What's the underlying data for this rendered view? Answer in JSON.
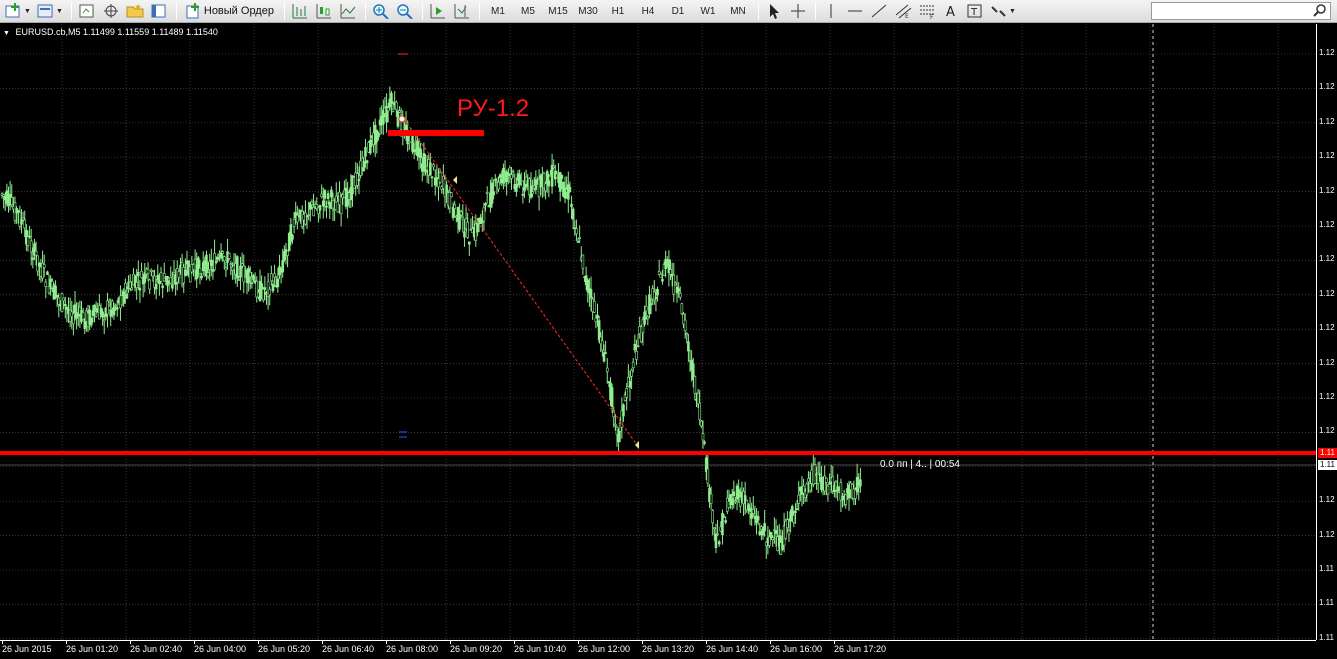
{
  "toolbar": {
    "new_order_label": "Новый Ордер",
    "timeframes": [
      "M1",
      "M5",
      "M15",
      "M30",
      "H1",
      "H4",
      "D1",
      "W1",
      "MN"
    ],
    "search_placeholder": ""
  },
  "chart": {
    "header": "EURUSD.cb,M5  1.11499 1.11559 1.11489 1.11540",
    "annotation": "РУ-1.2",
    "order_info": "0.0 пп | 4.. | 00:54",
    "price_labels": [
      "1.12",
      "1.12",
      "1.12",
      "1.12",
      "1.12",
      "1.12",
      "1.12",
      "1.12",
      "1.12",
      "1.12",
      "1.12",
      "1.12",
      "1.12",
      "1.12",
      "1.12",
      "1.11",
      "1.11",
      "1.11",
      "1.11"
    ],
    "current_price_tag": "1.11",
    "level_price_tag": "1.11",
    "time_labels": [
      "26 Jun 2015",
      "26 Jun 01:20",
      "26 Jun 02:40",
      "26 Jun 04:00",
      "26 Jun 05:20",
      "26 Jun 06:40",
      "26 Jun 08:00",
      "26 Jun 09:20",
      "26 Jun 10:40",
      "26 Jun 12:00",
      "26 Jun 13:20",
      "26 Jun 14:40",
      "26 Jun 16:00",
      "26 Jun 17:20"
    ],
    "colors": {
      "background": "#000000",
      "grid": "#5a5a5a",
      "candle": "#90ee90",
      "level": "#ff0000",
      "annotation": "#ff1a1a"
    }
  },
  "chart_data": {
    "type": "line",
    "title": "EURUSD.cb,M5",
    "x": [
      "00:00",
      "00:20",
      "00:40",
      "01:00",
      "01:20",
      "01:40",
      "02:00",
      "02:20",
      "02:40",
      "03:00",
      "03:20",
      "03:40",
      "04:00",
      "04:20",
      "04:40",
      "05:00",
      "05:20",
      "05:40",
      "06:00",
      "06:20",
      "06:40",
      "07:00",
      "07:20",
      "07:40",
      "08:00",
      "08:20",
      "08:40",
      "09:00",
      "09:20",
      "09:40",
      "10:00",
      "10:20",
      "10:40",
      "11:00",
      "11:20",
      "11:40",
      "12:00",
      "12:20",
      "12:40",
      "13:00",
      "13:20",
      "13:40",
      "14:00",
      "14:20",
      "14:40",
      "15:00",
      "15:20",
      "15:40",
      "16:00",
      "16:20",
      "16:40",
      "17:00",
      "17:20",
      "17:40"
    ],
    "y": [
      170,
      190,
      230,
      265,
      285,
      295,
      290,
      280,
      262,
      255,
      258,
      250,
      245,
      240,
      235,
      252,
      268,
      255,
      200,
      185,
      175,
      180,
      150,
      110,
      80,
      110,
      140,
      155,
      190,
      215,
      175,
      150,
      160,
      165,
      150,
      170,
      255,
      320,
      410,
      330,
      275,
      240,
      290,
      390,
      520,
      470,
      480,
      510,
      520,
      480,
      450,
      460,
      470,
      460
    ],
    "ylabel": "",
    "xlabel": "",
    "grid": true
  }
}
